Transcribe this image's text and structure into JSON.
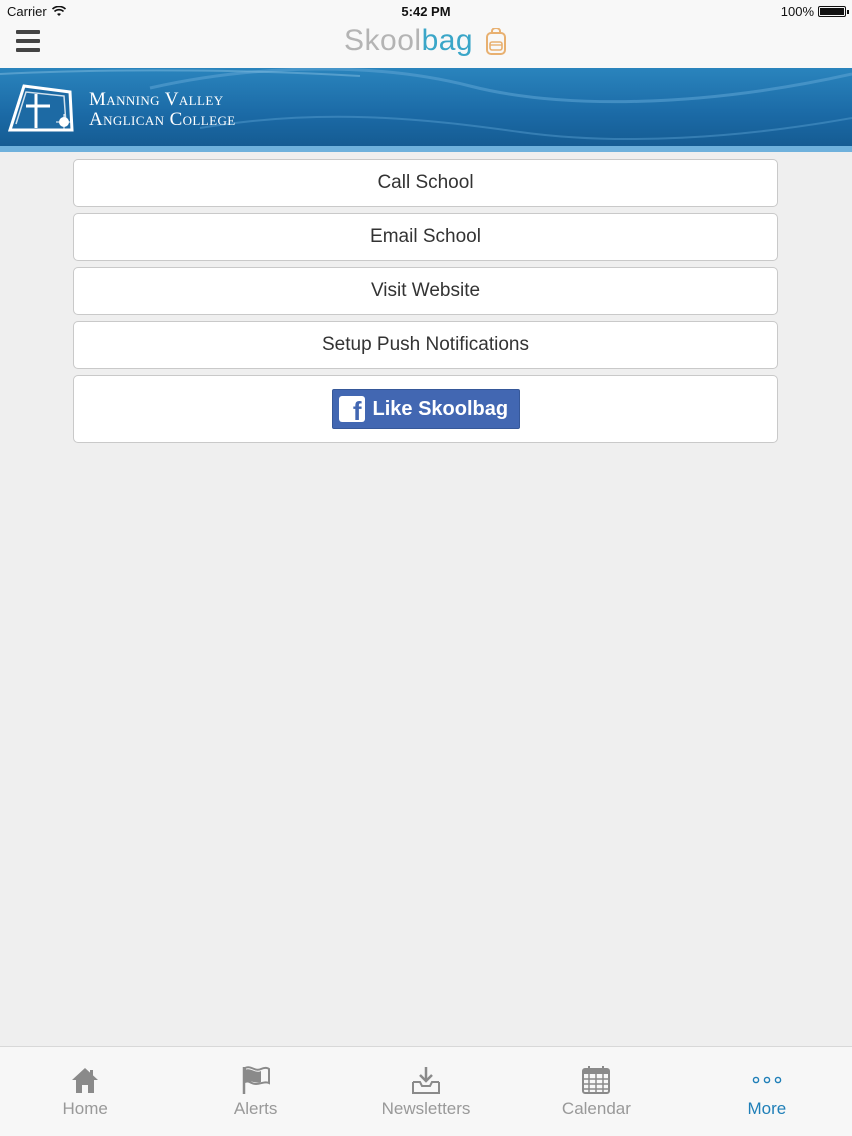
{
  "status_bar": {
    "carrier": "Carrier",
    "time": "5:42 PM",
    "battery": "100%",
    "battery_level": 1.0
  },
  "nav": {
    "logo_part1": "Skool",
    "logo_part2": "bag",
    "colors": {
      "skool": "#b4b4b4",
      "bag": "#3aa6c8"
    }
  },
  "banner": {
    "school_line1": "Manning Valley",
    "school_line2": "Anglican College"
  },
  "menu": {
    "items": [
      {
        "label": "Call School"
      },
      {
        "label": "Email School"
      },
      {
        "label": "Visit Website"
      },
      {
        "label": "Setup Push Notifications"
      }
    ],
    "facebook_label": "Like Skoolbag"
  },
  "tabs": [
    {
      "label": "Home",
      "icon": "home-icon"
    },
    {
      "label": "Alerts",
      "icon": "flag-icon"
    },
    {
      "label": "Newsletters",
      "icon": "inbox-download-icon"
    },
    {
      "label": "Calendar",
      "icon": "calendar-icon"
    },
    {
      "label": "More",
      "icon": "more-dots-icon",
      "active": true
    }
  ]
}
